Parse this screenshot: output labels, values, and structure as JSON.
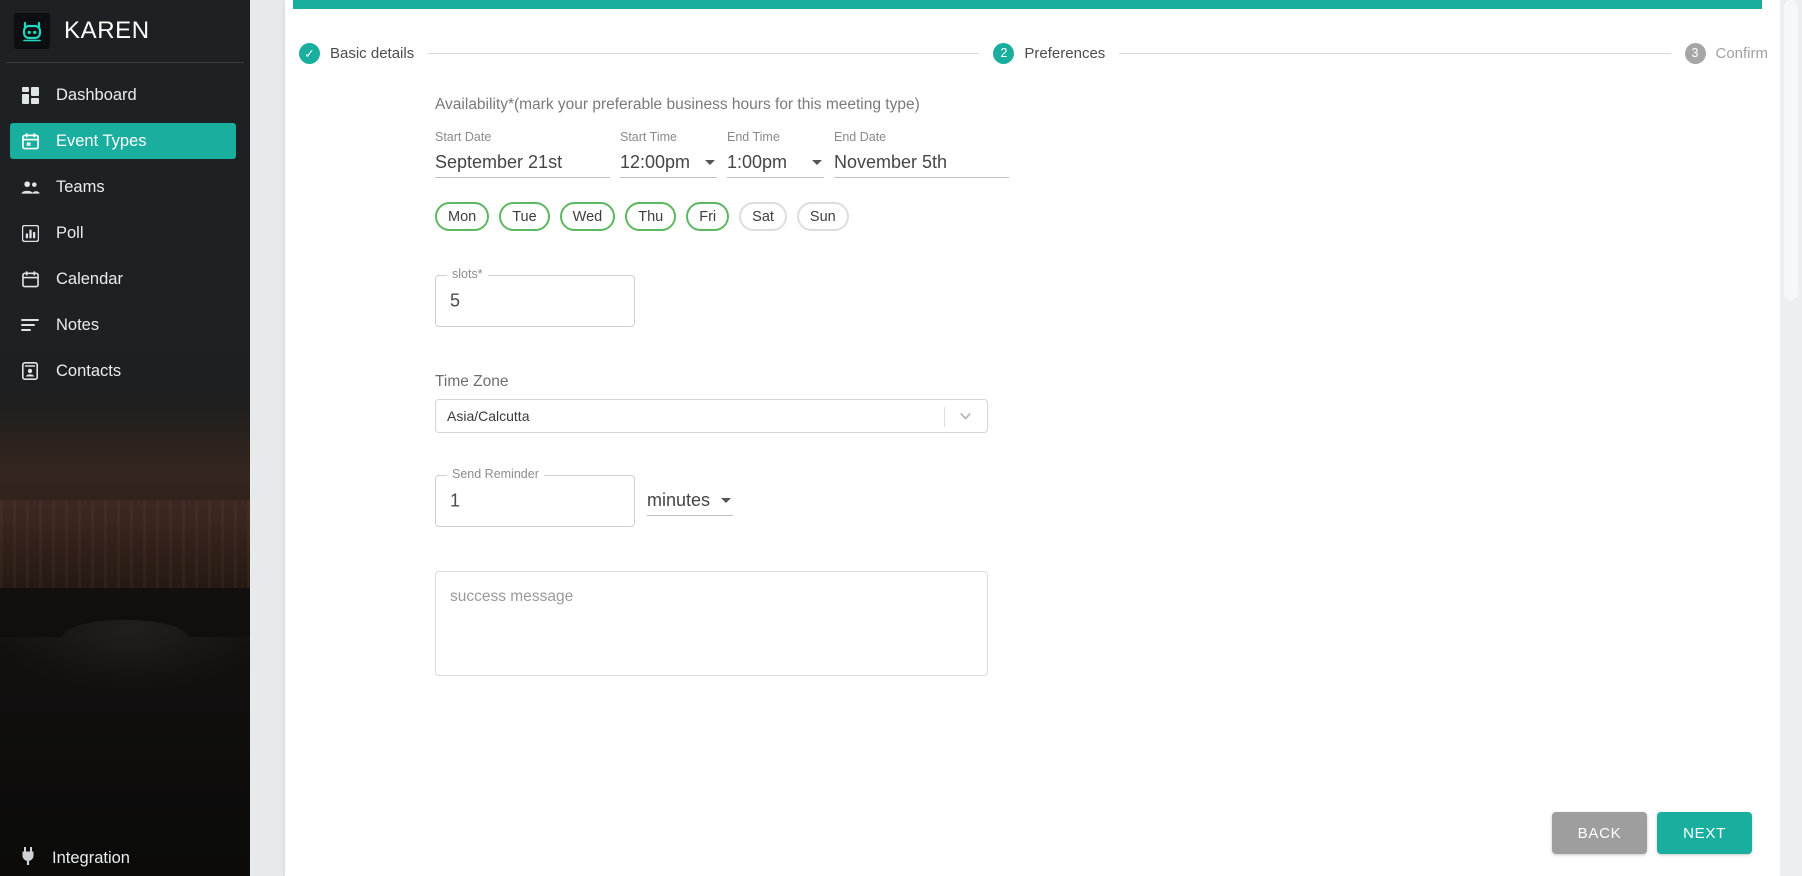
{
  "colors": {
    "accent_teal": "#1aae9f",
    "sidebar_dark": "#1d2124",
    "selected_day_green": "#5cb860",
    "back_button_gray": "#9e9e9e",
    "step_todo_gray": "#a6a6a6"
  },
  "sidebar": {
    "brand_name": "KAREN",
    "logo_icon": "robot-avatar-icon",
    "items": [
      {
        "label": "Dashboard",
        "icon": "dashboard-grid-icon",
        "active": false
      },
      {
        "label": "Event Types",
        "icon": "calendar-event-icon",
        "active": true
      },
      {
        "label": "Teams",
        "icon": "people-group-icon",
        "active": false
      },
      {
        "label": "Poll",
        "icon": "bar-chart-icon",
        "active": false
      },
      {
        "label": "Calendar",
        "icon": "calendar-icon",
        "active": false
      },
      {
        "label": "Notes",
        "icon": "lines-list-icon",
        "active": false
      },
      {
        "label": "Contacts",
        "icon": "contact-card-icon",
        "active": false
      }
    ],
    "bottom_item": {
      "label": "Integration",
      "icon": "power-plug-icon"
    }
  },
  "stepper": {
    "steps": [
      {
        "number": "✓",
        "label": "Basic details",
        "state": "done"
      },
      {
        "number": "2",
        "label": "Preferences",
        "state": "current"
      },
      {
        "number": "3",
        "label": "Confirm",
        "state": "todo"
      }
    ]
  },
  "form": {
    "availability_note": "Availability*(mark your preferable business hours for this meeting type)",
    "start_date": {
      "label": "Start Date",
      "value": "September 21st"
    },
    "start_time": {
      "label": "Start Time",
      "value": "12:00pm"
    },
    "end_time": {
      "label": "End Time",
      "value": "1:00pm"
    },
    "end_date": {
      "label": "End Date",
      "value": "November 5th"
    },
    "days": [
      {
        "label": "Mon",
        "selected": true
      },
      {
        "label": "Tue",
        "selected": true
      },
      {
        "label": "Wed",
        "selected": true
      },
      {
        "label": "Thu",
        "selected": true
      },
      {
        "label": "Fri",
        "selected": true
      },
      {
        "label": "Sat",
        "selected": false
      },
      {
        "label": "Sun",
        "selected": false
      }
    ],
    "slots": {
      "label": "slots*",
      "value": "5"
    },
    "time_zone": {
      "label": "Time Zone",
      "value": "Asia/Calcutta",
      "chevron_icon": "chevron-down-icon"
    },
    "send_reminder": {
      "label": "Send Reminder",
      "value": "1"
    },
    "reminder_unit": {
      "value": "minutes"
    },
    "success_message": {
      "placeholder": "success message"
    }
  },
  "footer": {
    "back_label": "BACK",
    "next_label": "NEXT"
  }
}
